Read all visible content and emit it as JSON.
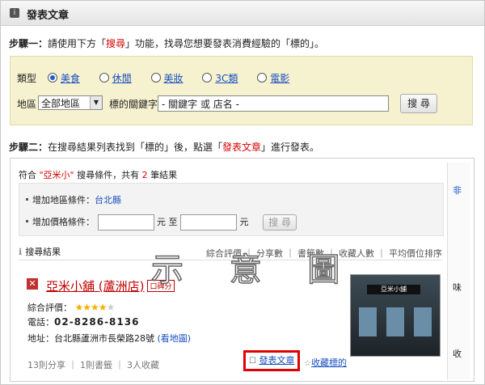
{
  "header": {
    "icon": "info-icon",
    "title": "發表文章"
  },
  "step1": {
    "label": "步驟一：",
    "text_pre": "請使用下方「",
    "search_word": "搜尋",
    "text_post": "」功能，找尋您想要發表消費經驗的「標的」。"
  },
  "search_panel": {
    "type_label": "類型",
    "types": [
      "美食",
      "休閒",
      "美妝",
      "3C類",
      "電影"
    ],
    "selected_type": "美食",
    "area_label": "地區",
    "area_value": "全部地區",
    "keyword_label": "標的關鍵字",
    "keyword_value": "- 關鍵字 或 店名 -",
    "search_button": "搜 尋"
  },
  "step2": {
    "label": "步驟二：",
    "text_pre": "在搜尋結果列表找到「標的」後，點選「",
    "post_word": "發表文章",
    "text_post": "」進行發表。"
  },
  "results": {
    "match_pre": "符合",
    "query": "\"亞米小\"",
    "match_mid": "搜尋條件，共有",
    "count": "2",
    "match_post": "筆結果",
    "area_filter_label": "增加地區條件：",
    "area_filter_value": "台北縣",
    "price_filter_label": "增加價格條件：",
    "price_unit": "元",
    "price_to": "至",
    "price_button": "搜 尋",
    "list_title": "搜尋結果",
    "sort_options": "綜合評價 ｜ 分享數 ｜ 書籤數 ｜ 收藏人數 ｜ 平均價位排序",
    "item": {
      "name": "亞米小舖 (蘆洲店)",
      "badge": "口碑分",
      "rating_label": "綜合評價：",
      "phone_label": "電話：",
      "phone": "02-8286-8136",
      "address_label": "地址：",
      "address": "台北縣蘆洲市長榮路28號",
      "map_link": "(看地圖)",
      "stats": "13則分享 ｜ 1則書籤 ｜ 3人收藏",
      "post_button": "發表文章",
      "collect_link": "收藏標的",
      "photo_sign": "亞米小舖"
    }
  },
  "sidebar": {
    "text1": "非",
    "text2": "味",
    "text3": "收"
  },
  "watermark": "示 意 圖"
}
